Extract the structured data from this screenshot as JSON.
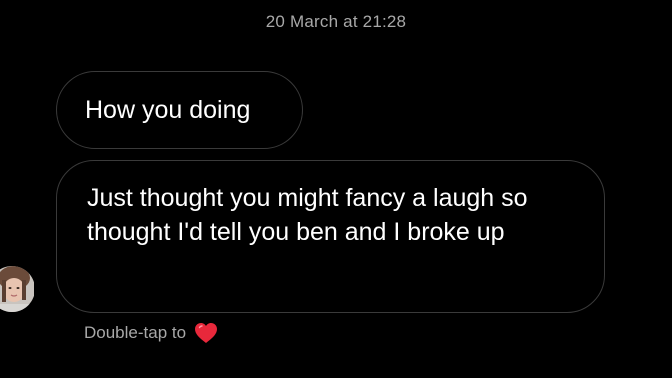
{
  "thread": {
    "timestamp": "20 March at 21:28"
  },
  "messages": [
    {
      "sender": "other",
      "text": "How you doing"
    },
    {
      "sender": "other",
      "text": "Just thought you might fancy a laugh so thought I'd tell you ben and I broke up"
    }
  ],
  "reaction_hint": {
    "label": "Double-tap to",
    "icon": "heart-icon",
    "icon_color": "#e8283b"
  },
  "colors": {
    "background": "#000000",
    "bubble_border": "#3a3a3a",
    "secondary_text": "#a8a8a8",
    "message_text": "#ffffff"
  }
}
